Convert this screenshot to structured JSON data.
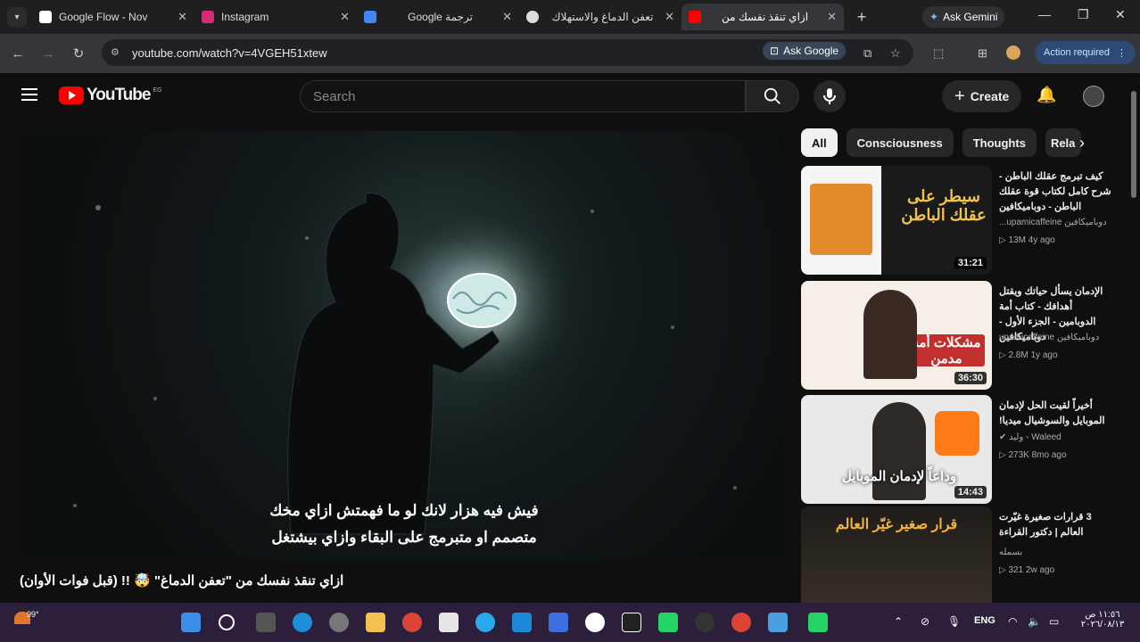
{
  "tabs": [
    {
      "title": "Google Flow - Nov",
      "fav": "#ffffff",
      "active": false
    },
    {
      "title": "Instagram",
      "fav": "#d62976",
      "active": false
    },
    {
      "title": "ترجمة Google",
      "fav": "#4285f4",
      "active": false
    },
    {
      "title": "تعفن الدماغ والاستهلاك",
      "fav": "#dddddd",
      "active": false
    },
    {
      "title": "ازاي تنقذ نفسك من",
      "fav": "#ff0000",
      "active": true
    }
  ],
  "browser": {
    "ask_gemini": "Ask Gemini",
    "url": "youtube.com/watch?v=4VGEH51xtew",
    "ask_google": "Ask Google",
    "action_required": "Action required"
  },
  "youtube": {
    "logo": "YouTube",
    "logo_cc": "EG",
    "search_placeholder": "Search",
    "create": "Create"
  },
  "video": {
    "subtitle_1": "فيش فيه هزار لانك لو ما فهمتش ازاي مخك",
    "subtitle_2": "متصمم او متبرمج على البقاء وازاي بيشتغل",
    "title": "ازاي تنقذ نفسك من \"تعفن الدماغ\" 🤯 !! (قبل فوات الأوان)"
  },
  "chips": [
    "All",
    "Consciousness",
    "Thoughts",
    "Rela"
  ],
  "recommendations": [
    {
      "title": "كيف تبرمج عقلك الباطن - شرح كامل لكتاب قوة عقلك الباطن - دوباميكافين",
      "channel": "دوباميكافين upamicaffeine...",
      "meta": "▷ 13M  4y ago",
      "duration": "31:21",
      "thumb_text": "سيطر على عقلك الباطن",
      "bg": "#f2f2f2",
      "accent": "#e28a2c"
    },
    {
      "title": "الإدمان يسأل حياتك ويقتل أهدافك - كتاب أمة الدوبامين - الجزء الأول - دوباميكافين",
      "channel": "دوباميكافين upamicaffeine",
      "meta": "▷ 2.8M  1y ago",
      "duration": "36:30",
      "thumb_text": "مشكلات أمة مدمن",
      "bg": "#f6efe8",
      "accent": "#c22f2f"
    },
    {
      "title": "أخيراً لقيت الحل لإدمان الموبايل والسوشيال ميديا!",
      "channel": "Waleed - وليد ✔",
      "meta": "▷ 273K  8mo ago",
      "duration": "14:43",
      "thumb_text": "وداعاً لإدمان الموبايل",
      "bg": "#e9e9e9",
      "accent": "#ff7a18"
    },
    {
      "title": "3 قرارات صغيرة غيّرت العالم | دكتور القراءة",
      "channel": "بسمله",
      "meta": "▷ 321  2w ago",
      "duration": "",
      "thumb_text": "قرار صغير غيّر العالم",
      "bg": "#2a2622",
      "accent": "#f3b33d"
    }
  ],
  "taskbar": {
    "temp": "99°",
    "lang": "ENG",
    "time": "١١:٥٦ ص",
    "date": "٢٠٢٦/٠٨/١٣"
  }
}
